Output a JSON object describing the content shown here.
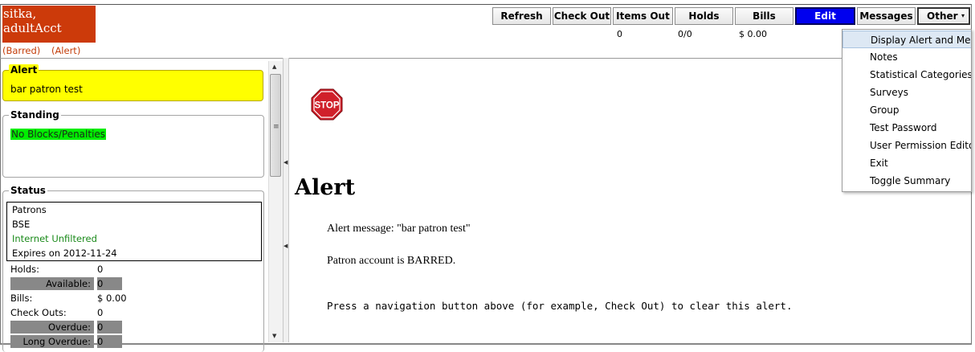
{
  "patron": {
    "name": "sitka, adultAcct",
    "flags": [
      "(Barred)",
      "(Alert)"
    ]
  },
  "nav": {
    "buttons": [
      {
        "label": "Refresh"
      },
      {
        "label": "Check Out"
      },
      {
        "label": "Items Out"
      },
      {
        "label": "Holds"
      },
      {
        "label": "Bills"
      },
      {
        "label": "Edit"
      },
      {
        "label": "Messages"
      },
      {
        "label": "Other"
      }
    ],
    "counts": {
      "items_out": "0",
      "holds": "0/0",
      "bills": "$ 0.00"
    }
  },
  "other_menu": {
    "items": [
      "Display Alert and Messages",
      "Notes",
      "Statistical Categories",
      "Surveys",
      "Group",
      "Test Password",
      "User Permission Editor",
      "Exit",
      "Toggle Summary"
    ]
  },
  "summary": {
    "alert": {
      "legend": "Alert",
      "text": "bar patron test"
    },
    "standing": {
      "legend": "Standing",
      "text": "No Blocks/Penalties"
    },
    "status": {
      "legend": "Status",
      "lines": [
        "Patrons",
        "BSE",
        "Internet Unfiltered",
        "Expires on 2012-11-24"
      ],
      "holds_label": "Holds:",
      "holds_value": "0",
      "available_label": "Available:",
      "available_value": "0",
      "bills_label": "Bills:",
      "bills_value": "$ 0.00",
      "checkouts_label": "Check Outs:",
      "checkouts_value": "0",
      "overdue_label": "Overdue:",
      "overdue_value": "0",
      "long_overdue_label": "Long Overdue:",
      "long_overdue_value": "0"
    }
  },
  "main": {
    "stop_label": "STOP",
    "heading": "Alert",
    "alert_message": "Alert message: \"bar patron test\"",
    "barred_message": "Patron account is BARRED.",
    "instruction": "Press a navigation button above (for example, Check Out) to clear this alert."
  },
  "colors": {
    "name_bg": "#cc3a0a",
    "alert_bg": "#ffff00",
    "standing_ok": "#00ee00",
    "edit_bg": "#0000ee",
    "stop_red": "#d0202a"
  }
}
